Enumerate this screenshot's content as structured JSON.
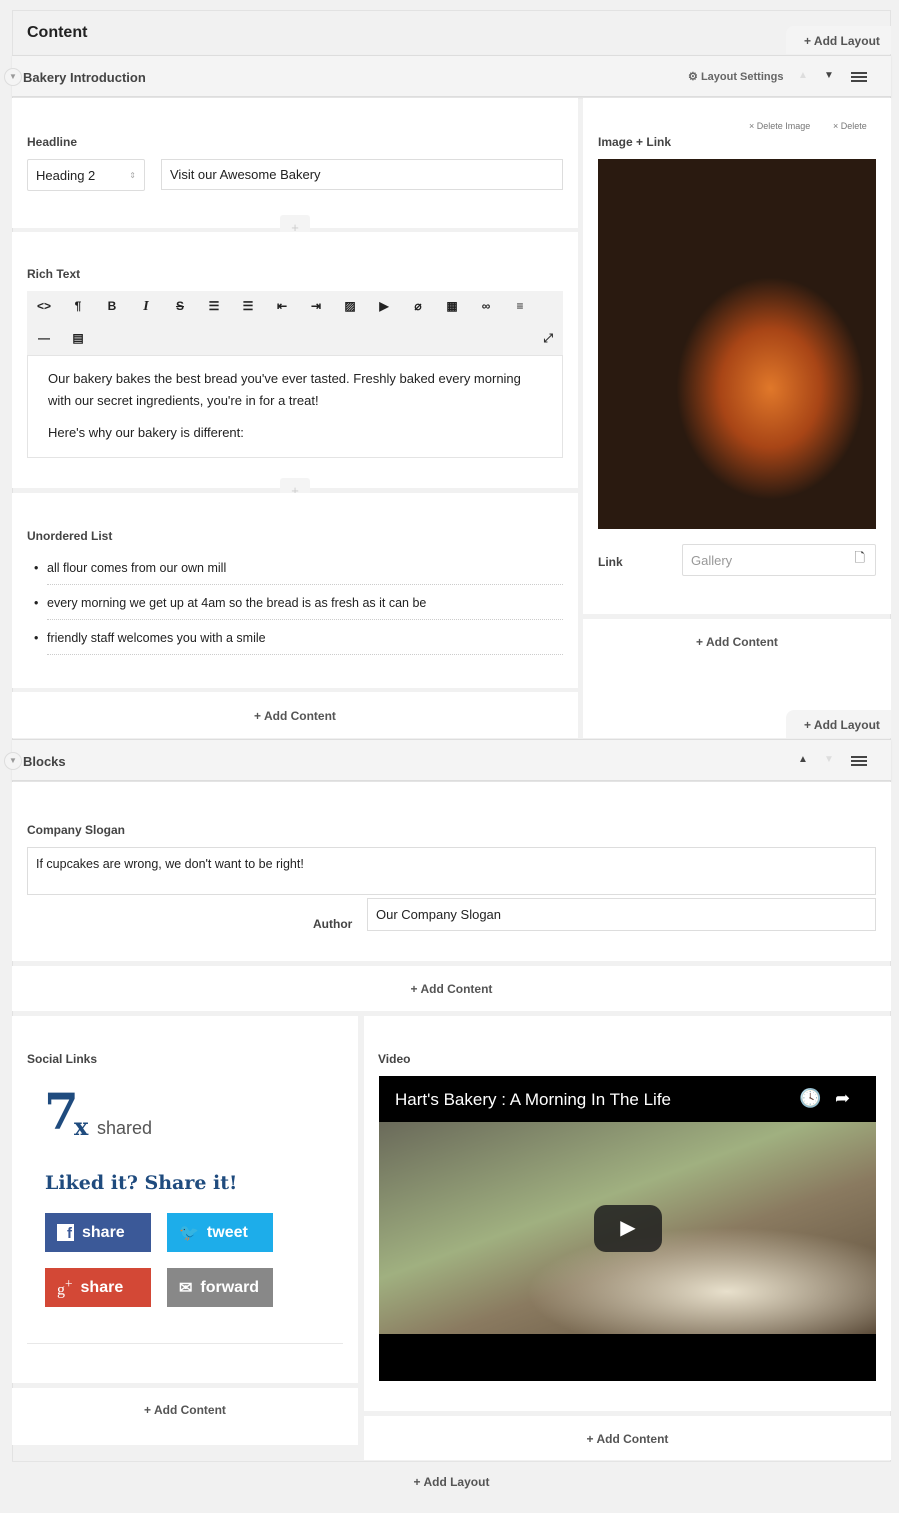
{
  "header": {
    "title": "Content",
    "add_layout": "+ Add Layout"
  },
  "layout1": {
    "title": "Bakery Introduction",
    "settings": "Layout Settings",
    "up": "▲",
    "down": "▼",
    "headline": {
      "label": "Headline",
      "select": "Heading 2",
      "value": "Visit our Awesome Bakery"
    },
    "richtext": {
      "label": "Rich Text",
      "toolbar": [
        "<>",
        "¶",
        "B",
        "I",
        "S",
        "bullet-list",
        "numbered-list",
        "outdent",
        "indent",
        "image",
        "video",
        "attachment",
        "table",
        "link",
        "align-left"
      ],
      "toolbar2": [
        "horizontal-rule",
        "paragraph-format"
      ],
      "p1": "Our bakery bakes the best bread you've ever tasted. Freshly baked every morning with our secret ingredients, you're in for a treat!",
      "p2": "Here's why our bakery is different:"
    },
    "list": {
      "label": "Unordered List",
      "items": [
        "all flour comes from our own mill",
        "every morning we get up at 4am so the bread is as fresh as it can be",
        "friendly staff welcomes you with a smile"
      ]
    },
    "add_content": "+ Add Content",
    "image": {
      "label": "Image + Link",
      "delete_image": "× Delete Image",
      "delete": "× Delete",
      "link_label": "Link",
      "link_placeholder": "Gallery"
    },
    "add_content_right": "+ Add Content",
    "add_layout": "+ Add Layout"
  },
  "layout2": {
    "title": "Blocks",
    "up": "▲",
    "down": "▼",
    "slogan": {
      "label": "Company Slogan",
      "value": "If cupcakes are wrong, we don't want to be right!",
      "author_label": "Author",
      "author_value": "Our Company Slogan"
    },
    "add_content": "+ Add Content",
    "social": {
      "label": "Social Links",
      "count": "7",
      "x": "x",
      "shared": "shared",
      "cta": "Liked it? Share it!",
      "buttons": [
        {
          "label": "share",
          "icon": "facebook-icon",
          "color": "#3b5998"
        },
        {
          "label": "tweet",
          "icon": "twitter-icon",
          "color": "#1dadea"
        },
        {
          "label": "share",
          "icon": "google-plus-icon",
          "color": "#d34836"
        },
        {
          "label": "forward",
          "icon": "mail-icon",
          "color": "#888888"
        }
      ],
      "add_content": "+ Add Content"
    },
    "video": {
      "label": "Video",
      "title": "Hart's Bakery : A Morning In The Life",
      "add_content": "+ Add Content"
    }
  },
  "footer": {
    "add_layout": "+ Add Layout"
  }
}
